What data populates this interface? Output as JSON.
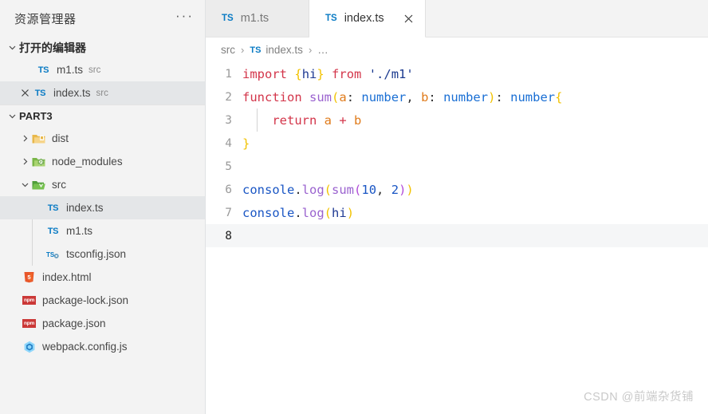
{
  "sidebar": {
    "title": "资源管理器",
    "more_actions": "···",
    "open_editors": {
      "label": "打开的编辑器",
      "twisty": "chevron-down-icon",
      "items": [
        {
          "name": "m1.ts",
          "folder": "src",
          "icon": "typescript-file-icon",
          "selected": false,
          "has_close": false
        },
        {
          "name": "index.ts",
          "folder": "src",
          "icon": "typescript-file-icon",
          "selected": true,
          "has_close": true,
          "close": "×"
        }
      ]
    },
    "workspace": {
      "label": "PART3",
      "twisty": "chevron-down-icon",
      "folders": [
        {
          "name": "dist",
          "icon": "folder-yellow-icon",
          "twisty": "chevron-right-icon",
          "expanded": false
        },
        {
          "name": "node_modules",
          "icon": "folder-node-icon",
          "twisty": "chevron-right-icon",
          "expanded": false
        },
        {
          "name": "src",
          "icon": "folder-src-open-icon",
          "twisty": "chevron-down-icon",
          "expanded": true
        }
      ],
      "src_children": [
        {
          "name": "index.ts",
          "icon": "typescript-file-icon",
          "selected": true
        },
        {
          "name": "m1.ts",
          "icon": "typescript-file-icon",
          "selected": false
        },
        {
          "name": "tsconfig.json",
          "icon": "tsconfig-file-icon",
          "selected": false
        }
      ],
      "root_files": [
        {
          "name": "index.html",
          "icon": "html5-file-icon"
        },
        {
          "name": "package-lock.json",
          "icon": "npm-file-icon",
          "badge": "npm"
        },
        {
          "name": "package.json",
          "icon": "npm-file-icon",
          "badge": "npm"
        },
        {
          "name": "webpack.config.js",
          "icon": "webpack-file-icon"
        }
      ]
    }
  },
  "tabs": [
    {
      "name": "m1.ts",
      "icon": "typescript-file-icon",
      "badge": "TS",
      "active": false,
      "close": ""
    },
    {
      "name": "index.ts",
      "icon": "typescript-file-icon",
      "badge": "TS",
      "active": true,
      "close": "✕"
    }
  ],
  "breadcrumb": {
    "folder": "src",
    "separator": "›",
    "badge": "TS",
    "file": "index.ts",
    "overflow": "…"
  },
  "editor": {
    "active_line": 8,
    "lines": [
      {
        "n": "1"
      },
      {
        "n": "2"
      },
      {
        "n": "3"
      },
      {
        "n": "4"
      },
      {
        "n": "5"
      },
      {
        "n": "6"
      },
      {
        "n": "7"
      },
      {
        "n": "8"
      }
    ],
    "source_text": [
      "import {hi} from './m1'",
      "function sum(a: number, b: number): number{",
      "    return a + b",
      "}",
      "",
      "console.log(sum(10, 2))",
      "console.log(hi)",
      ""
    ]
  },
  "watermark": "CSDN @前端杂货铺",
  "colors": {
    "sidebar_bg": "#f3f3f3",
    "editor_bg": "#ffffff",
    "selection_bg": "#e4e6e8",
    "ts_blue": "#0a7bc4",
    "npm_red": "#cb3837",
    "keyword_red": "#d3354a",
    "function_purple": "#9a62cf",
    "type_blue": "#1a6fd4",
    "param_orange": "#e07b1b",
    "bracket_gold": "#f2c200"
  }
}
